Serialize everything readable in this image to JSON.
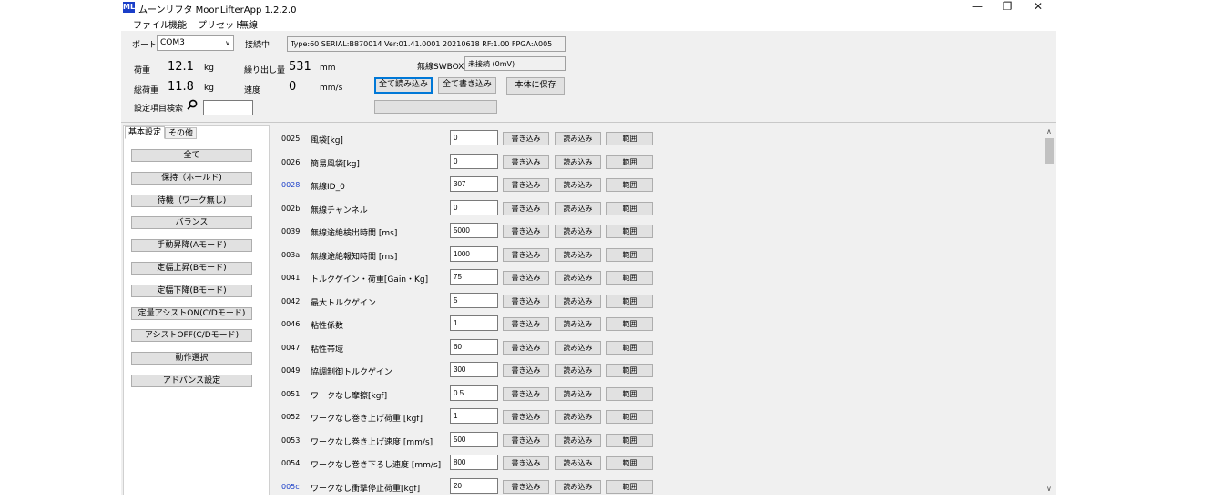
{
  "titlebar": {
    "icon_text": "ML",
    "title": "ムーンリフタ MoonLifterApp 1.2.2.0",
    "minimize_glyph": "—",
    "maximize_glyph": "❐",
    "close_glyph": "✕"
  },
  "menu": [
    "ファイル",
    "機能",
    "プリセット",
    "無線"
  ],
  "connection": {
    "port_label": "ポート",
    "port_value": "COM3",
    "status": "接続中",
    "device_info": "Type:60 SERIAL:B870014 Ver:01.41.0001 20210618 RF:1.00 FPGA:A005"
  },
  "readouts": {
    "load_label": "荷重",
    "load_value": "12.1",
    "load_unit": "kg",
    "total_load_label": "総荷重",
    "total_load_value": "11.8",
    "total_load_unit": "kg",
    "payout_label": "繰り出し量",
    "payout_value": "531",
    "payout_unit": "mm",
    "speed_label": "速度",
    "speed_value": "0",
    "speed_unit": "mm/s"
  },
  "wireless": {
    "label": "無線SWBOX",
    "value": "未接続 (0mV)"
  },
  "actions": {
    "read_all": "全て読み込み",
    "write_all": "全て書き込み",
    "save_device": "本体に保存"
  },
  "search": {
    "label": "設定項目検索",
    "value": ""
  },
  "tabs": [
    "基本設定",
    "その他"
  ],
  "side_buttons": [
    "全て",
    "保持（ホールド)",
    "待機（ワーク無し)",
    "バランス",
    "手動昇降(Aモード)",
    "定幅上昇(Bモード)",
    "定幅下降(Bモード)",
    "定量アシストON(C/Dモード)",
    "アシストOFF(C/Dモード)",
    "動作選択",
    "アドバンス設定"
  ],
  "row_buttons": {
    "write": "書き込み",
    "read": "読み込み",
    "range": "範囲"
  },
  "params": [
    {
      "code": "0025",
      "name": "風袋[kg]",
      "value": "0"
    },
    {
      "code": "0026",
      "name": "簡易風袋[kg]",
      "value": "0"
    },
    {
      "code": "0028",
      "name": "無線ID_0",
      "value": "307",
      "highlight": true
    },
    {
      "code": "002b",
      "name": "無線チャンネル",
      "value": "0"
    },
    {
      "code": "0039",
      "name": "無線途絶検出時間 [ms]",
      "value": "5000"
    },
    {
      "code": "003a",
      "name": "無線途絶報知時間 [ms]",
      "value": "1000"
    },
    {
      "code": "0041",
      "name": "トルクゲイン・荷重[Gain・Kg]",
      "value": "75"
    },
    {
      "code": "0042",
      "name": "最大トルクゲイン",
      "value": "5"
    },
    {
      "code": "0046",
      "name": "粘性係数",
      "value": "1"
    },
    {
      "code": "0047",
      "name": "粘性帯域",
      "value": "60"
    },
    {
      "code": "0049",
      "name": "協調制御トルクゲイン",
      "value": "300"
    },
    {
      "code": "0051",
      "name": "ワークなし摩擦[kgf]",
      "value": "0.5"
    },
    {
      "code": "0052",
      "name": "ワークなし巻き上げ荷重 [kgf]",
      "value": "1"
    },
    {
      "code": "0053",
      "name": "ワークなし巻き上げ速度 [mm/s]",
      "value": "500"
    },
    {
      "code": "0054",
      "name": "ワークなし巻き下ろし速度 [mm/s]",
      "value": "800"
    },
    {
      "code": "005c",
      "name": "ワークなし衝撃停止荷重[kgf]",
      "value": "20",
      "highlight": true
    }
  ],
  "colors": {
    "accent": "#1a3ec8",
    "panel": "#f0f0f0",
    "button": "#e1e1e1"
  }
}
